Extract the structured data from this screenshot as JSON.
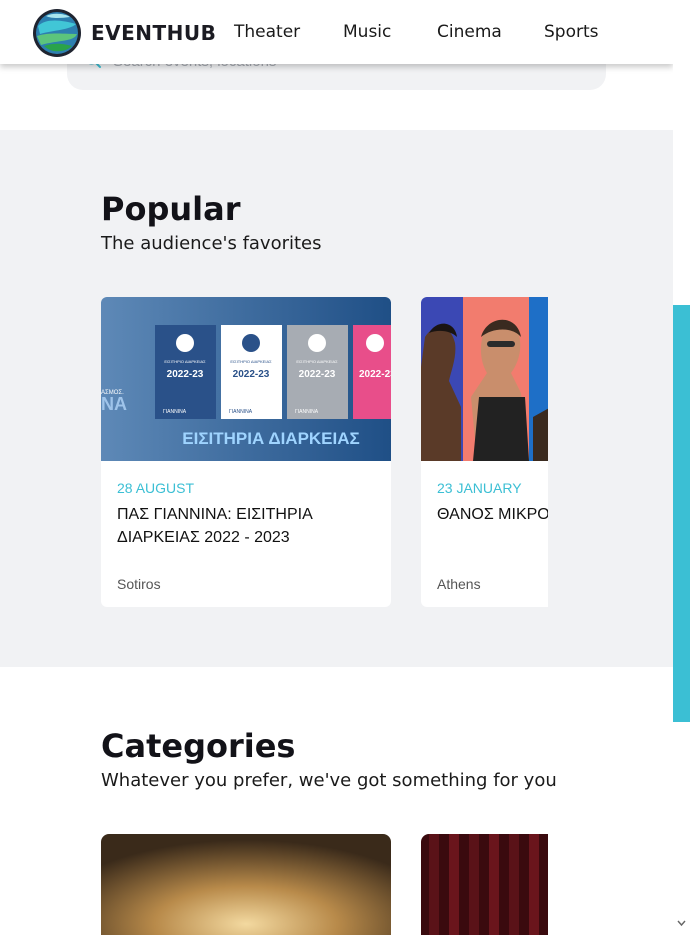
{
  "header": {
    "brand": "EVENTHUB",
    "nav": [
      "Theater",
      "Music",
      "Cinema",
      "Sports"
    ]
  },
  "search": {
    "placeholder": "Search events, locations"
  },
  "popular": {
    "title": "Popular",
    "subtitle": "The audience's favorites",
    "cards": [
      {
        "date": "28 AUGUST",
        "title": "ΠΑΣ ΓΙΑΝΝΙΝΑ: ΕΙΣΙΤΗΡΙΑ ΔΙΑΡΚΕΙΑΣ 2022 - 2023",
        "location": "Sotiros",
        "image": {
          "banner_text": "ΕΙΣΙΤΗΡΙΑ ΔΙΑΡΚΕΙΑΣ",
          "side_text": "ΝΑ",
          "side_small": "ΑΣΜΟΣ.",
          "ticket_year": "2022-23",
          "ticket_label": "ΕΙΣΙΤΗΡΙΟ ΔΙΑΡΚΕΙΑΣ",
          "ticket_city": "ΓΙΑΝΝΙΝΑ"
        }
      },
      {
        "date": "23 JANUARY",
        "title": "ΘΑΝΟΣ ΜΙΚΡΟ έργα",
        "location": "Athens"
      }
    ]
  },
  "categories": {
    "title": "Categories",
    "subtitle": "Whatever you prefer, we've got something for you"
  },
  "colors": {
    "accent": "#3bbfd4",
    "section_bg": "#f1f2f4",
    "ticket_blue": "#2a5189",
    "ticket_pink": "#e84e8a"
  }
}
